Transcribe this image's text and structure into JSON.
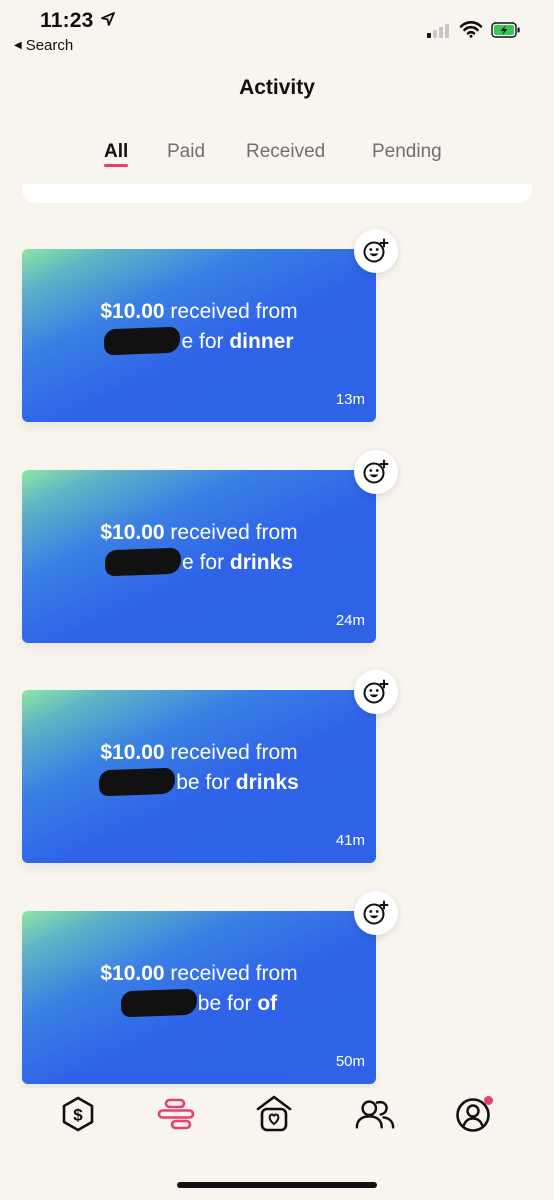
{
  "status_bar": {
    "time": "11:23",
    "back_label": "Search",
    "signal_bars_filled": 1,
    "signal_bars_total": 4,
    "battery_color": "#34c759",
    "icons": [
      "location-arrow-icon",
      "signal-icon",
      "wifi-icon",
      "battery-charging-icon"
    ]
  },
  "header": {
    "title": "Activity"
  },
  "tabs": [
    {
      "label": "All",
      "active": true
    },
    {
      "label": "Paid",
      "active": false
    },
    {
      "label": "Received",
      "active": false
    },
    {
      "label": "Pending",
      "active": false
    }
  ],
  "colors": {
    "accent": "#e8406e",
    "background": "#f8f4ee",
    "card_blue": "#2f64e8",
    "card_green": "#8fe6a4"
  },
  "activities": [
    {
      "amount": "$10.00",
      "verb": "received from",
      "name_suffix": "e",
      "for_word": "for",
      "note": "dinner",
      "time": "13m",
      "reaction_icon": "smiley-plus-icon"
    },
    {
      "amount": "$10.00",
      "verb": "received from",
      "name_suffix": "e",
      "for_word": "for",
      "note": "drinks",
      "time": "24m",
      "reaction_icon": "smiley-plus-icon"
    },
    {
      "amount": "$10.00",
      "verb": "received from",
      "name_suffix": "be",
      "for_word": "for",
      "note": "drinks",
      "time": "41m",
      "reaction_icon": "smiley-plus-icon"
    },
    {
      "amount": "$10.00",
      "verb": "received from",
      "name_suffix": "be",
      "for_word": "for",
      "note": "of",
      "time": "50m",
      "reaction_icon": "smiley-plus-icon"
    }
  ],
  "bottom_nav": [
    {
      "icon": "dollar-badge-icon",
      "active": false
    },
    {
      "icon": "activity-bars-icon",
      "active": true
    },
    {
      "icon": "house-heart-icon",
      "active": false
    },
    {
      "icon": "friends-icon",
      "active": false
    },
    {
      "icon": "profile-icon",
      "active": false,
      "has_notification_dot": true
    }
  ]
}
